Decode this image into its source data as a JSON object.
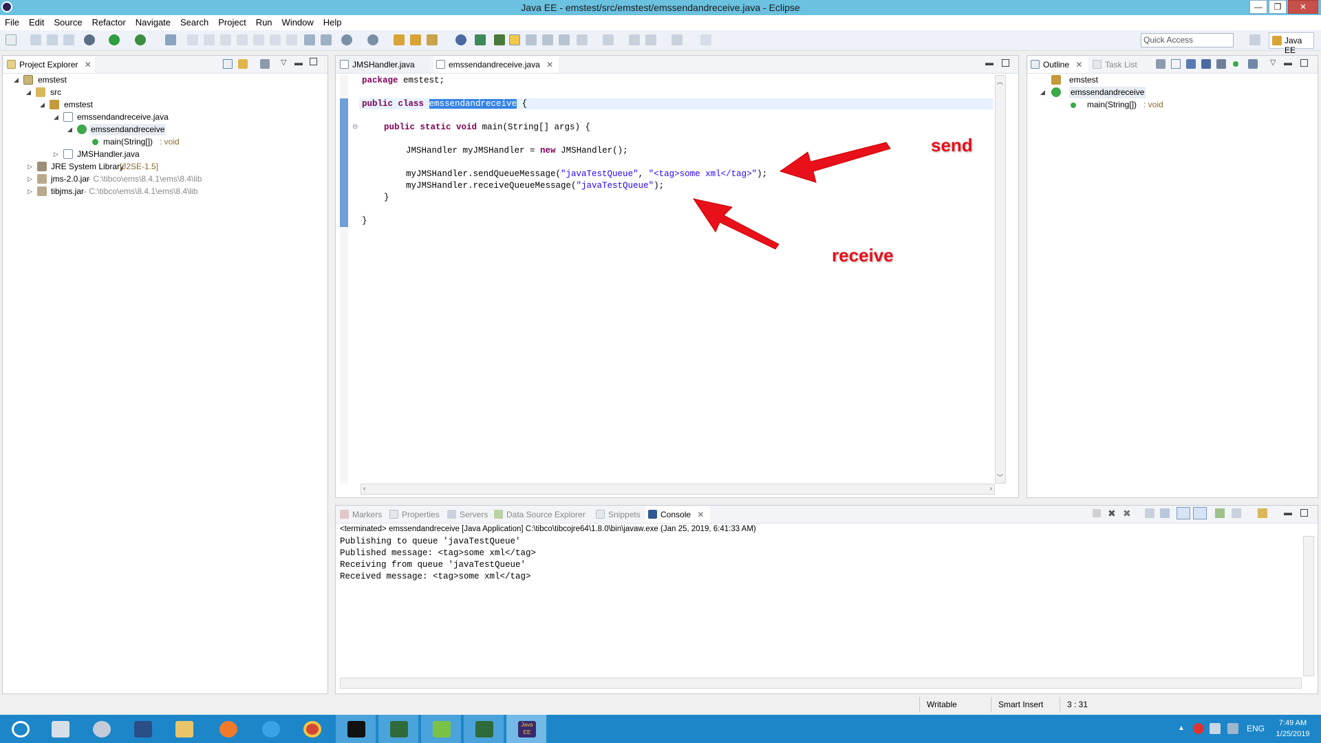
{
  "window": {
    "title": "Java EE - emstest/src/emstest/emssendandreceive.java - Eclipse",
    "min": "—",
    "max": "❐",
    "close": "✕"
  },
  "menu": [
    "File",
    "Edit",
    "Source",
    "Refactor",
    "Navigate",
    "Search",
    "Project",
    "Run",
    "Window",
    "Help"
  ],
  "toolbar": {
    "quick_access_placeholder": "Quick Access",
    "perspective": "Java EE"
  },
  "project_explorer": {
    "tab": "Project Explorer",
    "tree": [
      {
        "label": "emstest",
        "suffix": ""
      },
      {
        "label": "src",
        "suffix": ""
      },
      {
        "label": "emstest",
        "suffix": ""
      },
      {
        "label": "emssendandreceive.java",
        "suffix": ""
      },
      {
        "label": "emssendandreceive",
        "suffix": ""
      },
      {
        "label": "main(String[])",
        "suffix": " : void"
      },
      {
        "label": "JMSHandler.java",
        "suffix": ""
      },
      {
        "label": "JRE System Library",
        "suffix": " [J2SE-1.5]"
      },
      {
        "label": "jms-2.0.jar",
        "suffix": " - C:\\tibco\\ems\\8.4.1\\ems\\8.4\\lib"
      },
      {
        "label": "tibjms.jar",
        "suffix": " - C:\\tibco\\ems\\8.4.1\\ems\\8.4\\lib"
      }
    ]
  },
  "editor": {
    "tabs": [
      "JMSHandler.java",
      "emssendandreceive.java"
    ],
    "code": {
      "l1_kw": "package",
      "l1_rest": " emstest;",
      "l2_kw": "public class",
      "l2_sel": "emssendandreceive",
      "l2_rest": " {",
      "l3_kw": "public static void",
      "l3_rest": " main(String[] args) {",
      "l4_a": "JMSHandler myJMSHandler = ",
      "l4_kw": "new",
      "l4_b": " JMSHandler();",
      "l5_a": "myJMSHandler.sendQueueMessage(",
      "l5_s1": "\"javaTestQueue\"",
      "l5_b": ", ",
      "l5_s2": "\"<tag>some xml</tag>\"",
      "l5_c": ");",
      "l6_a": "myJMSHandler.receiveQueueMessage(",
      "l6_s1": "\"javaTestQueue\"",
      "l6_b": ");",
      "l7": "}",
      "l8": "}"
    },
    "annotations": {
      "send": "send",
      "receive": "receive"
    }
  },
  "outline": {
    "tabs": [
      "Outline",
      "Task List"
    ],
    "tree": [
      {
        "label": "emstest",
        "suffix": ""
      },
      {
        "label": "emssendandreceive",
        "suffix": ""
      },
      {
        "label": "main(String[])",
        "suffix": " : void"
      }
    ]
  },
  "bottom": {
    "tabs": [
      "Markers",
      "Properties",
      "Servers",
      "Data Source Explorer",
      "Snippets",
      "Console"
    ],
    "console_header": "<terminated> emssendandreceive [Java Application] C:\\tibco\\tibcojre64\\1.8.0\\bin\\javaw.exe (Jan 25, 2019, 6:41:33 AM)",
    "console_lines": [
      "Publishing to queue 'javaTestQueue'",
      "Published message: <tag>some xml</tag>",
      "Receiving from queue 'javaTestQueue'",
      "Received message: <tag>some xml</tag>"
    ]
  },
  "status": {
    "writable": "Writable",
    "insert": "Smart Insert",
    "position": "3 : 31"
  },
  "taskbar": {
    "lang": "ENG",
    "time": "7:49 AM",
    "date": "1/25/2019",
    "javaee_label": "Java EE IDE"
  },
  "colors": {
    "titlebar": "#6bc1e0",
    "taskbar": "#1c86c9",
    "arrow": "#e8101a",
    "keyword": "#7f0055",
    "string": "#2a00ff"
  }
}
